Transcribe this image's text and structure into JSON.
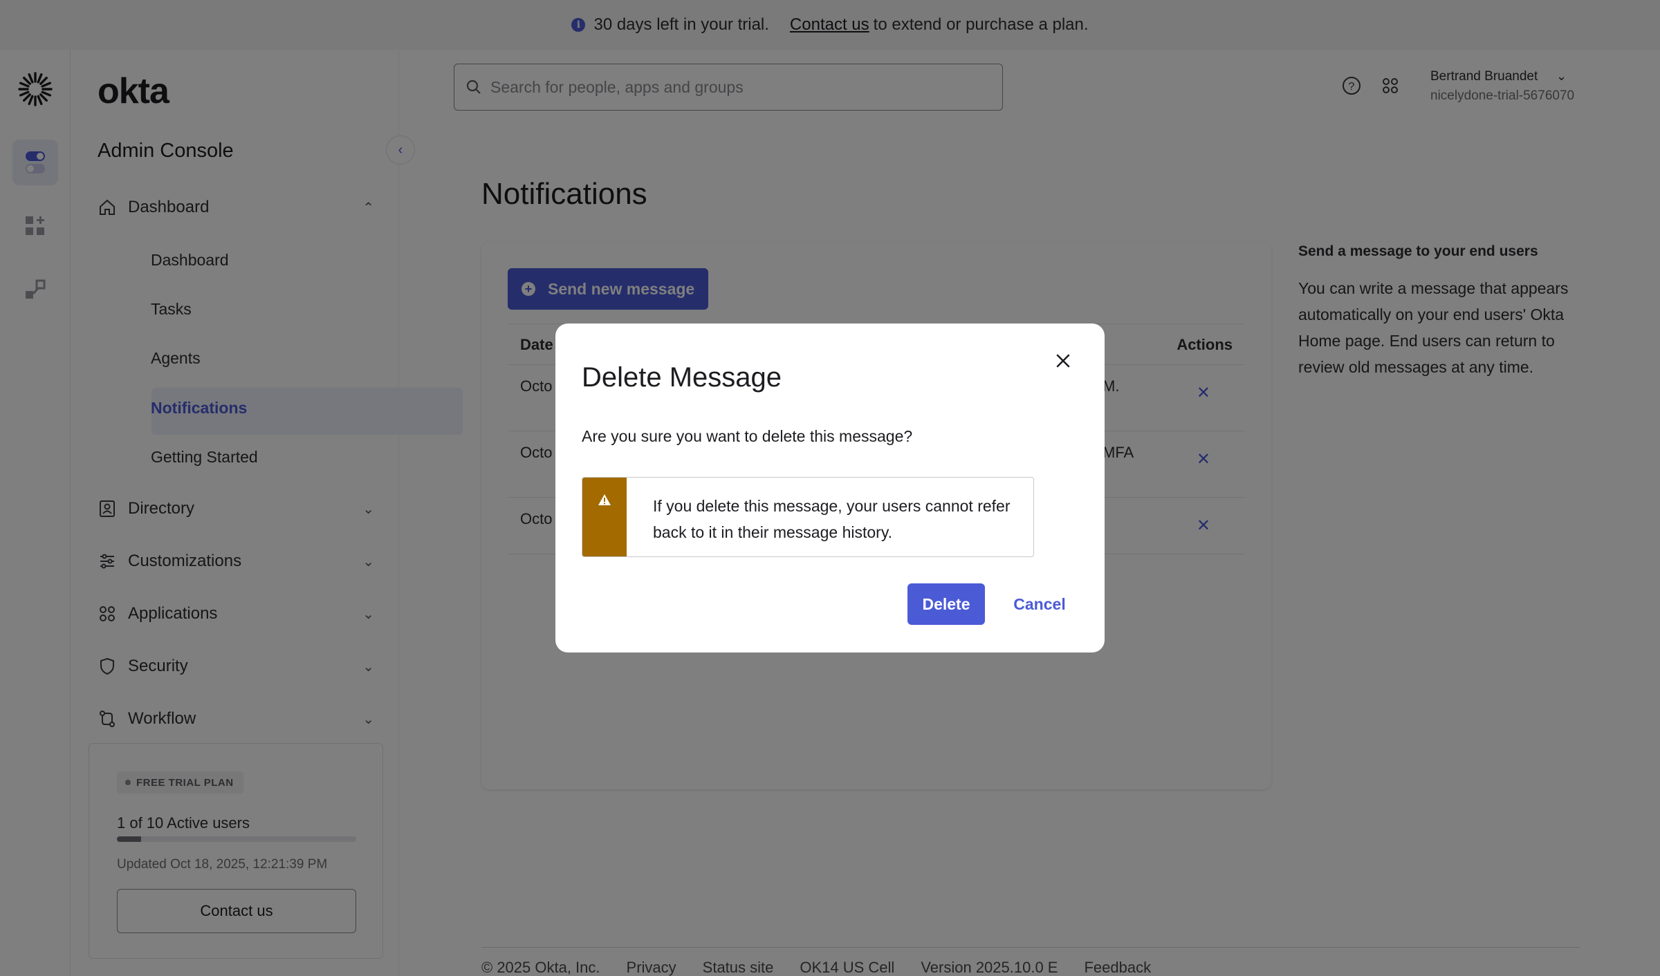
{
  "banner": {
    "text_before": "30 days left in your trial.",
    "link": "Contact us",
    "text_after": "to extend or purchase a plan."
  },
  "brand": {
    "wordmark": "okta",
    "console_title": "Admin Console"
  },
  "search": {
    "placeholder": "Search for people, apps and groups"
  },
  "user": {
    "name": "Bertrand Bruandet",
    "org": "nicelydone-trial-5676070"
  },
  "nav": {
    "groups": [
      {
        "label": "Dashboard",
        "icon": "home-icon",
        "expanded": true
      },
      {
        "label": "Directory",
        "icon": "directory-icon"
      },
      {
        "label": "Customizations",
        "icon": "sliders-icon"
      },
      {
        "label": "Applications",
        "icon": "grid-icon"
      },
      {
        "label": "Security",
        "icon": "shield-icon"
      },
      {
        "label": "Workflow",
        "icon": "workflow-icon"
      }
    ],
    "dashboard_items": [
      "Dashboard",
      "Tasks",
      "Agents",
      "Notifications",
      "Getting Started"
    ],
    "active_item": "Notifications"
  },
  "trial": {
    "badge": "FREE TRIAL PLAN",
    "users": "1 of 10 Active users",
    "usage_fraction": 0.1,
    "updated": "Updated Oct 18, 2025, 12:21:39 PM",
    "contact_label": "Contact us"
  },
  "page": {
    "title": "Notifications",
    "send_button": "Send new message",
    "table": {
      "col_date": "Date",
      "col_actions": "Actions",
      "rows": [
        {
          "date": "Octo",
          "tail": "M."
        },
        {
          "date": "Octo",
          "tail": "MFA"
        },
        {
          "date": "Octo",
          "tail": ""
        }
      ]
    }
  },
  "help": {
    "title": "Send a message to your end users",
    "body": "You can write a message that appears automatically on your end users' Okta Home page. End users can return to review old messages at any time."
  },
  "footer": {
    "links": [
      "© 2025 Okta, Inc.",
      "Privacy",
      "Status site",
      "OK14 US Cell",
      "Version 2025.10.0 E",
      "Feedback"
    ]
  },
  "modal": {
    "title": "Delete Message",
    "question": "Are you sure you want to delete this message?",
    "warning": "If you delete this message, your users cannot refer back to it in their message history.",
    "delete_label": "Delete",
    "cancel_label": "Cancel"
  },
  "colors": {
    "accent": "#4b5bd6",
    "warning": "#a36a00"
  }
}
